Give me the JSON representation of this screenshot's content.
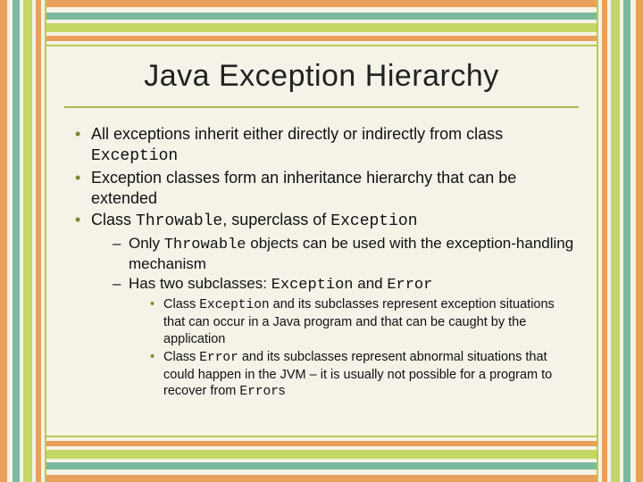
{
  "title": "Java Exception Hierarchy",
  "b1_a": "All exceptions inherit either directly or indirectly from class ",
  "b1_code": "Exception",
  "b2": "Exception classes form an inheritance hierarchy that can be extended",
  "b3_a": "Class ",
  "b3_code1": "Throwable",
  "b3_b": ", superclass of ",
  "b3_code2": "Exception",
  "s1_a": "Only ",
  "s1_code": "Throwable",
  "s1_b": " objects can be used with the exception-handling mechanism",
  "s2_a": "Has two subclasses: ",
  "s2_code1": "Exception",
  "s2_b": " and ",
  "s2_code2": "Error",
  "t1_a": "Class ",
  "t1_code": "Exception",
  "t1_b": " and its subclasses represent exception situations that can occur in a Java program and that can be caught by the application",
  "t2_a": "Class ",
  "t2_code1": "Error",
  "t2_b": " and its subclasses represent abnormal situations that could happen in the JVM – it is usually not possible for a program to recover from ",
  "t2_code2": "Error",
  "t2_c": "s"
}
